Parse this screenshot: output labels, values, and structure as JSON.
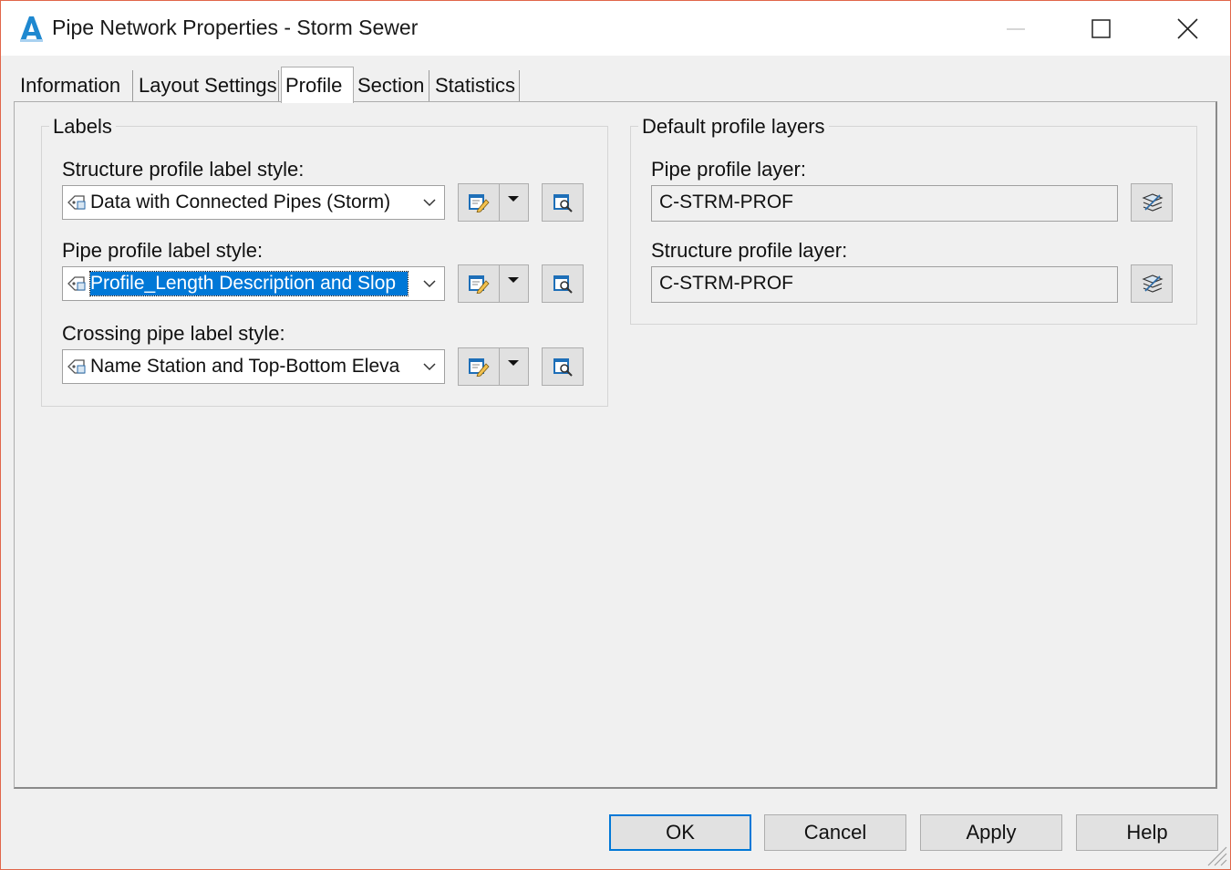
{
  "window": {
    "title": "Pipe Network Properties - Storm Sewer",
    "app_icon_letter": "A"
  },
  "tabs": [
    {
      "label": "Information",
      "active": false
    },
    {
      "label": "Layout Settings",
      "active": false
    },
    {
      "label": "Profile",
      "active": true
    },
    {
      "label": "Section",
      "active": false
    },
    {
      "label": "Statistics",
      "active": false
    }
  ],
  "labels_group": {
    "title": "Labels",
    "structure_label": "Structure profile label style:",
    "structure_value": "Data with Connected Pipes (Storm)",
    "pipe_label": "Pipe profile label style:",
    "pipe_value": "Profile_Length Description and Slop",
    "crossing_label": "Crossing pipe label style:",
    "crossing_value": "Name Station and Top-Bottom Eleva"
  },
  "layers_group": {
    "title": "Default profile layers",
    "pipe_layer_label": "Pipe profile layer:",
    "pipe_layer_value": "C-STRM-PROF",
    "structure_layer_label": "Structure profile layer:",
    "structure_layer_value": "C-STRM-PROF"
  },
  "buttons": {
    "ok": "OK",
    "cancel": "Cancel",
    "apply": "Apply",
    "help": "Help"
  },
  "colors": {
    "accent": "#0078d7",
    "window_border": "#e1664a",
    "app_icon": "#1e88d0"
  },
  "icons": [
    "app-logo-icon",
    "minimize-icon",
    "maximize-icon",
    "close-icon",
    "label-style-icon",
    "chevron-down-icon",
    "edit-style-icon",
    "dropdown-arrow-icon",
    "details-icon",
    "layer-icon",
    "resize-grip-icon"
  ]
}
